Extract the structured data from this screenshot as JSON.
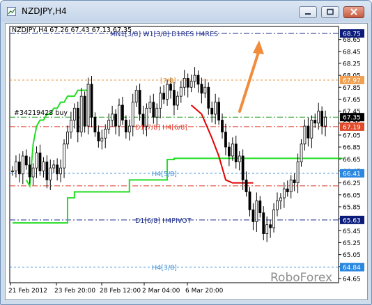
{
  "window": {
    "title": "NZDJPY,H4",
    "buttons": [
      "minimize",
      "maximize",
      "close"
    ]
  },
  "chart_data": {
    "type": "candlestick",
    "info_line": "NZDJPY,H4  67.26 67.43 67.13 67.35",
    "x_ticks": [
      "21 Feb 2012",
      "23 Feb 20:00",
      "28 Feb 12:00",
      "2 Mar 04:00",
      "6 Mar 20:00"
    ],
    "y_ticks": [
      64.65,
      64.85,
      65.05,
      65.25,
      65.45,
      65.65,
      65.85,
      66.05,
      66.25,
      66.45,
      66.65,
      66.85,
      67.05,
      67.25,
      67.45,
      67.65,
      67.85,
      68.05,
      68.25,
      68.45,
      68.65
    ],
    "ylim": [
      64.58,
      68.82
    ],
    "level_labels": [
      {
        "text": "MN1[3/8] W1[3/8] D1RES H4RES",
        "price": 68.75,
        "color": "#1a2a8a"
      },
      {
        "text": "[7/8]",
        "price": 67.97,
        "color": "#e8963c"
      },
      {
        "text": "D1[7/8] H4[6/8]",
        "price": 67.19,
        "color": "#dd3a2a"
      },
      {
        "text": "H4[5/8]",
        "price": 66.41,
        "color": "#3a8ed8"
      },
      {
        "text": "D1[6/8] H4PIVOT",
        "price": 65.63,
        "color": "#1a2a8a"
      },
      {
        "text": "H4[3/8]",
        "price": 64.84,
        "color": "#3a8ed8"
      }
    ],
    "order_label": "#34219428 buy",
    "order_price": 67.35,
    "price_tags": [
      {
        "text": "68.75",
        "price": 68.75,
        "bg": "#0b1b7a"
      },
      {
        "text": "67.97",
        "price": 67.97,
        "bg": "#f0a050"
      },
      {
        "text": "67.35",
        "price": 67.35,
        "bg": "#000000"
      },
      {
        "text": "67.19",
        "price": 67.19,
        "bg": "#e04a2a"
      },
      {
        "text": "66.41",
        "price": 66.41,
        "bg": "#2a88e0"
      },
      {
        "text": "65.63",
        "price": 65.63,
        "bg": "#0b1b7a"
      },
      {
        "text": "64.84",
        "price": 64.84,
        "bg": "#2a88e0"
      }
    ],
    "watermark": "RoboForex",
    "colors": {
      "candles": "#000000",
      "green_line": "#22dd22",
      "red_line": "#e60000",
      "arrow": "#f08c3c",
      "order_line": "#1a9a1a"
    },
    "close_prices": [
      66.45,
      66.6,
      66.4,
      66.7,
      66.55,
      66.35,
      66.5,
      66.75,
      66.45,
      66.6,
      66.3,
      66.5,
      66.55,
      66.4,
      66.5,
      66.9,
      67.1,
      67.3,
      67.5,
      67.1,
      67.7,
      67.2,
      67.9,
      67.35,
      67.1,
      66.95,
      67.0,
      67.15,
      67.3,
      67.4,
      67.2,
      67.55,
      67.3,
      67.1,
      67.2,
      67.6,
      67.8,
      67.4,
      67.2,
      67.5,
      67.6,
      67.35,
      67.5,
      67.75,
      67.65,
      67.9,
      67.8,
      67.55,
      67.7,
      67.85,
      68.0,
      67.85,
      67.95,
      68.05,
      67.9,
      67.75,
      67.85,
      67.5,
      67.4,
      67.6,
      67.3,
      67.1,
      66.85,
      66.7,
      66.9,
      66.6,
      66.7,
      66.3,
      66.1,
      65.8,
      65.6,
      65.95,
      65.75,
      65.4,
      65.55,
      65.5,
      65.8,
      65.95,
      66.0,
      66.15,
      66.1,
      66.3,
      66.25,
      66.6,
      66.9,
      67.2,
      67.0,
      67.3,
      67.25,
      67.45,
      67.2,
      67.35
    ],
    "green_steps": [
      [
        0,
        65.58
      ],
      [
        16,
        66.0
      ],
      [
        18,
        66.1
      ],
      [
        34,
        66.3
      ],
      [
        45,
        66.64
      ],
      [
        47,
        66.66
      ],
      [
        96,
        66.66
      ]
    ],
    "trailing_green": [
      66.3,
      66.2,
      66.9,
      67.2,
      67.3,
      67.3,
      67.4,
      67.4,
      67.5,
      67.5,
      67.6,
      67.6,
      67.7,
      67.7,
      67.7,
      67.8,
      67.8,
      67.8,
      67.8
    ]
  }
}
